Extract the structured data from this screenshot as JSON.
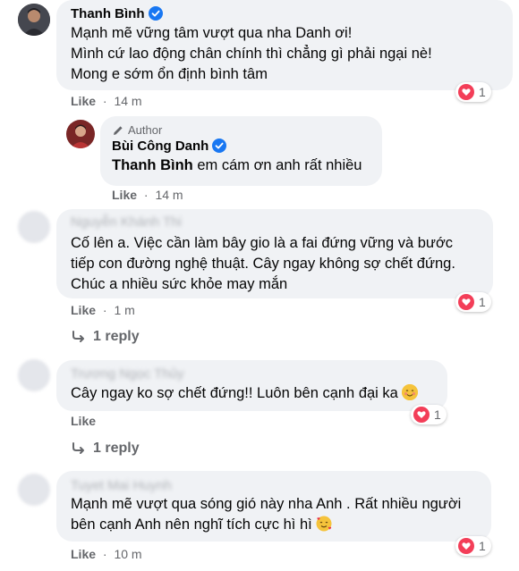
{
  "comments": [
    {
      "name": "Thanh Bình",
      "lines": [
        "Mạnh mẽ vững tâm vượt qua nha Danh ơi!",
        "Mình cứ lao động chân chính thì chẳng gì phải ngại nè!",
        "Mong e sớm ổn định bình tâm"
      ],
      "like": "Like",
      "time": "14 m",
      "reactions": "1"
    },
    {
      "author_tag": "Author",
      "name": "Bùi Công Danh",
      "mention": "Thanh Bình",
      "text": " em cám ơn anh rất nhiều",
      "like": "Like",
      "time": "14 m"
    },
    {
      "name": "Nguyễn Khánh Thi",
      "lines": [
        "Cố lên a. Việc cần làm bây gio là a fai đứng vững và bước",
        "tiếp con đường nghệ thuật. Cây ngay không sợ chết đứng.",
        "Chúc a nhiều sức khỏe may mắn"
      ],
      "like": "Like",
      "time": "1 m",
      "reactions": "1",
      "reply": "1 reply"
    },
    {
      "name": "Trương Ngọc Thủy",
      "lines": [
        "Cây ngay ko sợ chết đứng!! Luôn bên cạnh đại ka"
      ],
      "like": "Like",
      "reactions": "1",
      "reply": "1 reply"
    },
    {
      "name": "Tuyet Mai Huynh",
      "lines": [
        "Mạnh mẽ vượt qua sóng gió này nha Anh . Rất nhiều người",
        "bên cạnh Anh nên nghĩ tích cực hì hì"
      ],
      "like": "Like",
      "time": "10 m",
      "reactions": "1"
    }
  ],
  "separator": "·",
  "colors": {
    "bubble": "#f0f2f5",
    "secondary_text": "#65676b",
    "verified": "#1877f2",
    "love": "#f33e58"
  },
  "icons": [
    "verified-badge-icon",
    "love-reaction-icon",
    "reply-arrow-icon",
    "author-pen-icon",
    "smiling-blush-emoji",
    "smiling-hearts-emoji"
  ]
}
